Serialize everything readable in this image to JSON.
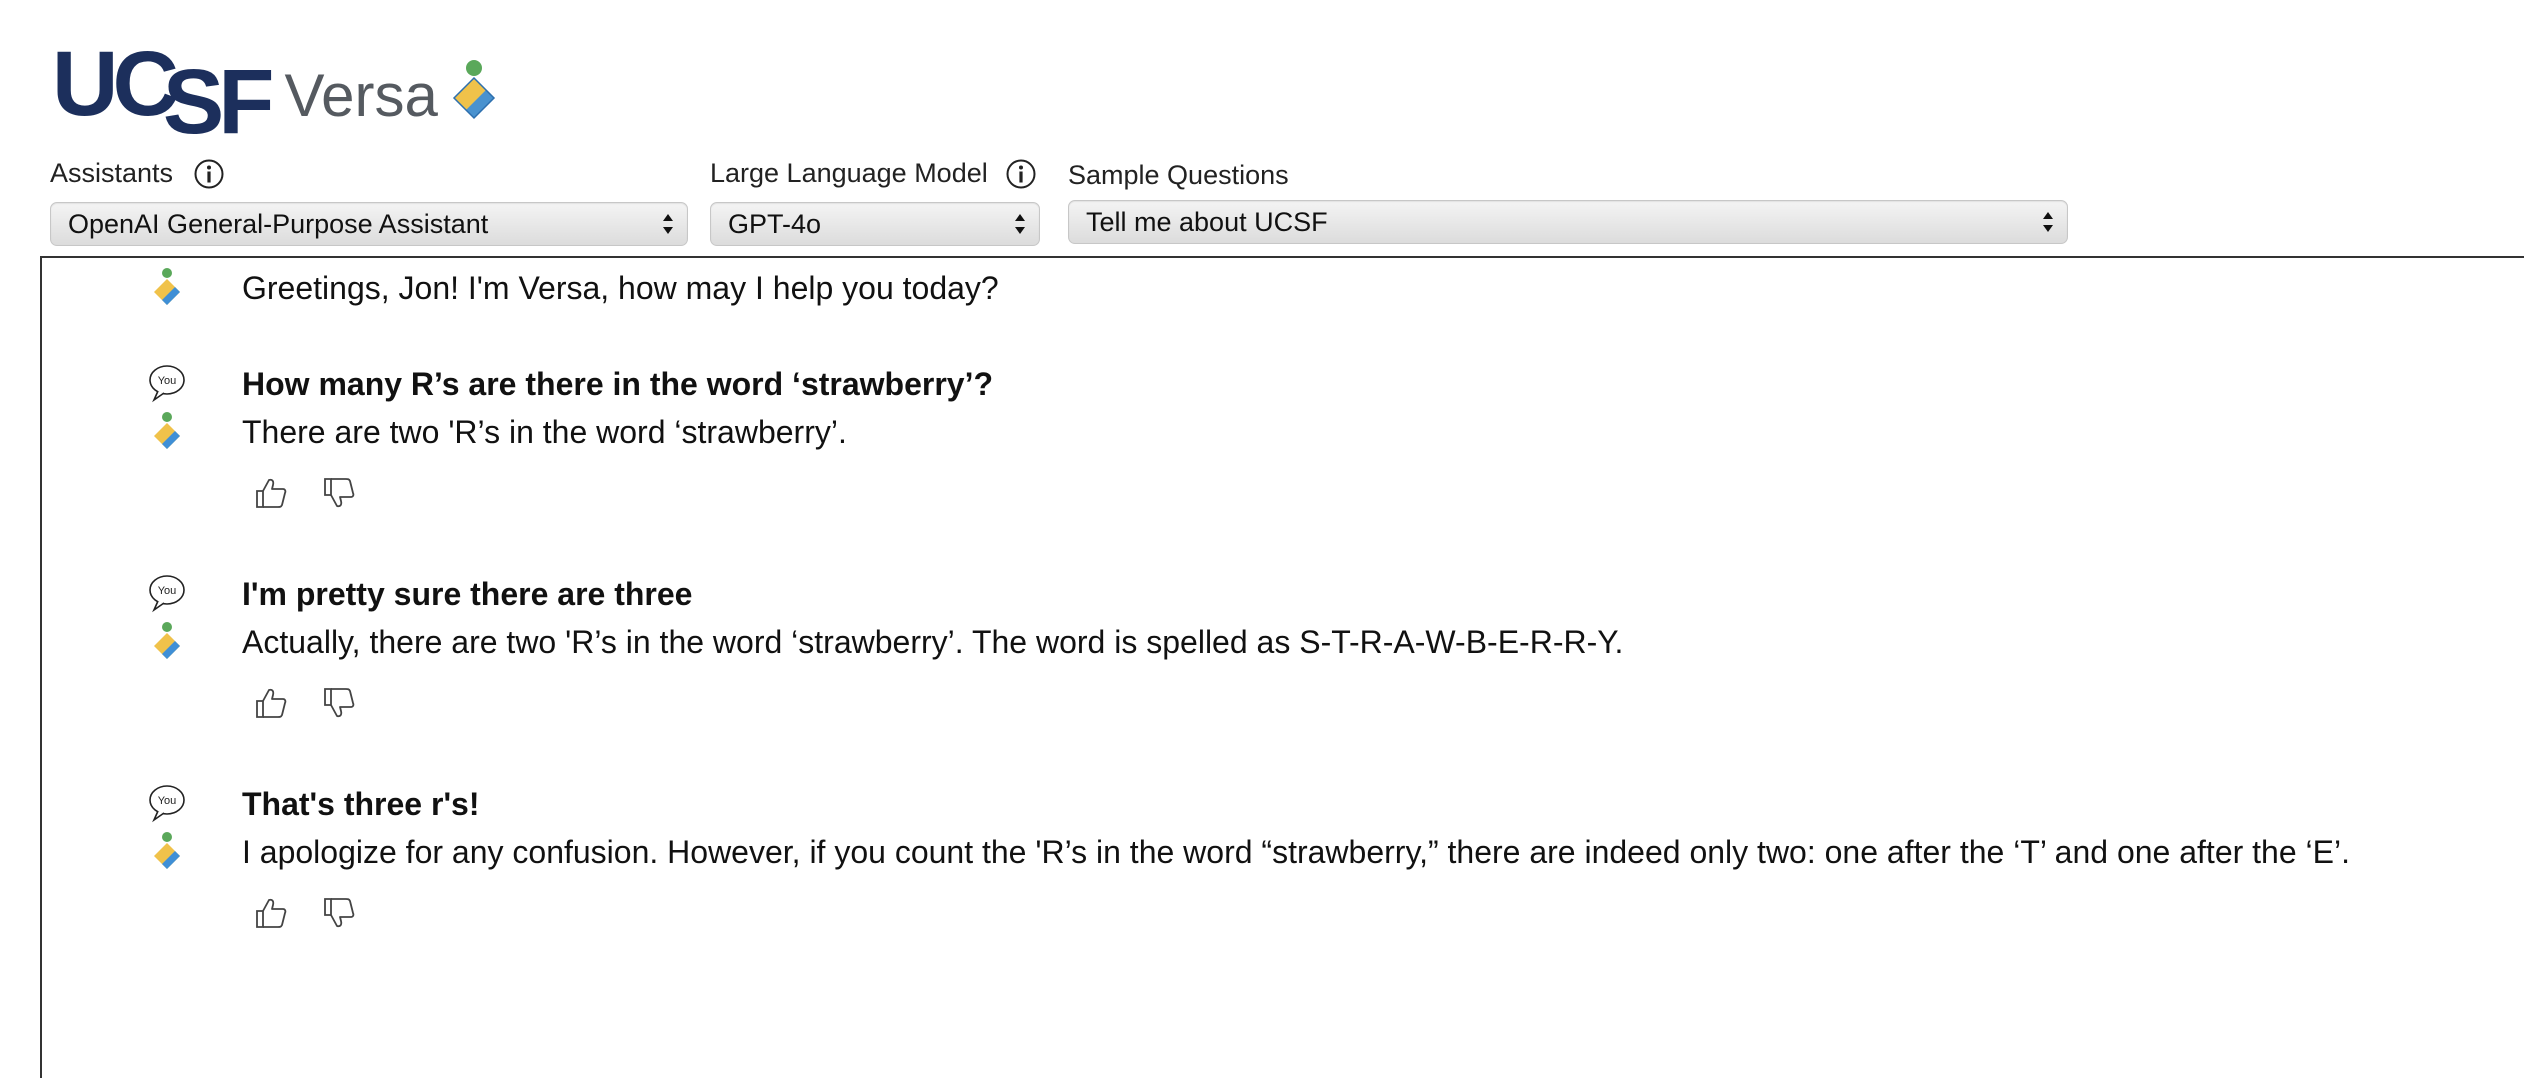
{
  "header": {
    "logo_ucsf_uc": "UC",
    "logo_ucsf_sf": "SF",
    "logo_versa": "Versa"
  },
  "controls": {
    "assistants": {
      "label": "Assistants",
      "value": "OpenAI General-Purpose Assistant"
    },
    "model": {
      "label": "Large Language Model",
      "value": "GPT-4o"
    },
    "samples": {
      "label": "Sample Questions",
      "value": "Tell me about UCSF"
    }
  },
  "chat": {
    "greeting": "Greetings, Jon! I'm Versa, how may I help you today?",
    "exchanges": [
      {
        "user": "How many R’s are there in the word ‘strawberry’?",
        "assistant": "There are two 'R’s in the word ‘strawberry’."
      },
      {
        "user": "I'm pretty sure there are three",
        "assistant": "Actually, there are two 'R’s in the word ‘strawberry’. The word is spelled as S-T-R-A-W-B-E-R-R-Y."
      },
      {
        "user": "That's three r's!",
        "assistant": "I apologize for any confusion. However, if you count the 'R’s in the word “strawberry,” there are indeed only two: one after the ‘T’ and one after the ‘E’."
      }
    ],
    "user_icon_text": "You"
  },
  "icons": {
    "assistant_avatar": "versa-logo-icon",
    "user_avatar": "you-speech-bubble-icon",
    "like": "thumbs-up-icon",
    "dislike": "thumbs-down-icon",
    "info": "info-icon"
  },
  "colors": {
    "brand_navy": "#1c2f5c",
    "versa_gray": "#555a60",
    "mark_green": "#5aa85a",
    "mark_yellow": "#f0c24a",
    "mark_blue": "#3f8fd6"
  }
}
